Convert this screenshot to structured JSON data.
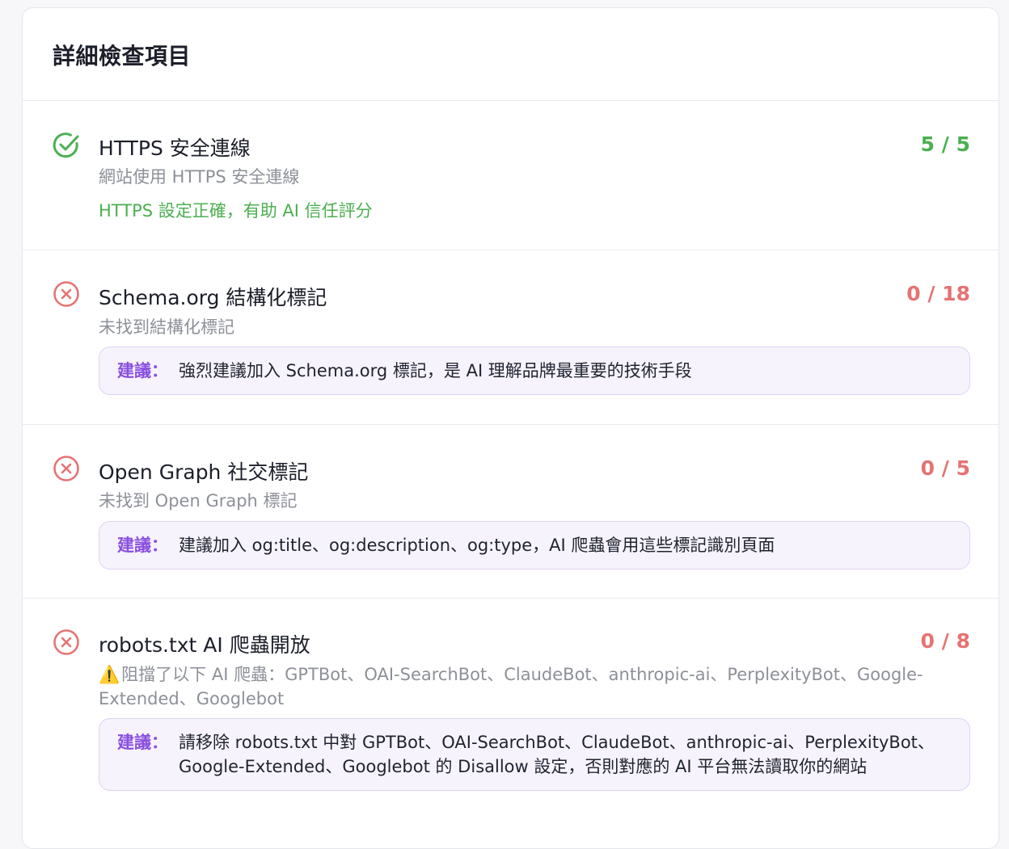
{
  "section_title": "詳細檢查項目",
  "suggestion_label": "建議：",
  "colors": {
    "pass": "#4caf50",
    "fail": "#e57373",
    "suggestion_label": "#8a4fe0",
    "suggestion_bg": "#f6f3fc"
  },
  "items": [
    {
      "status": "pass",
      "icon": "check-circle-icon",
      "title": "HTTPS 安全連線",
      "score": "5 / 5",
      "description": "網站使用 HTTPS 安全連線",
      "result": "HTTPS 設定正確，有助 AI 信任評分"
    },
    {
      "status": "fail",
      "icon": "x-circle-icon",
      "title": "Schema.org 結構化標記",
      "score": "0 / 18",
      "description": "未找到結構化標記",
      "suggestion": "強烈建議加入 Schema.org 標記，是 AI 理解品牌最重要的技術手段"
    },
    {
      "status": "fail",
      "icon": "x-circle-icon",
      "title": "Open Graph 社交標記",
      "score": "0 / 5",
      "description": "未找到 Open Graph 標記",
      "suggestion": "建議加入 og:title、og:description、og:type，AI 爬蟲會用這些標記識別頁面"
    },
    {
      "status": "fail",
      "icon": "x-circle-icon",
      "title": "robots.txt AI 爬蟲開放",
      "score": "0 / 8",
      "warning_icon": "warning-icon",
      "warning_symbol": "⚠️",
      "description": "阻擋了以下 AI 爬蟲：GPTBot、OAI-SearchBot、ClaudeBot、anthropic-ai、PerplexityBot、Google-Extended、Googlebot",
      "suggestion": "請移除 robots.txt 中對 GPTBot、OAI-SearchBot、ClaudeBot、anthropic-ai、PerplexityBot、Google-Extended、Googlebot 的 Disallow 設定，否則對應的 AI 平台無法讀取你的網站"
    }
  ]
}
